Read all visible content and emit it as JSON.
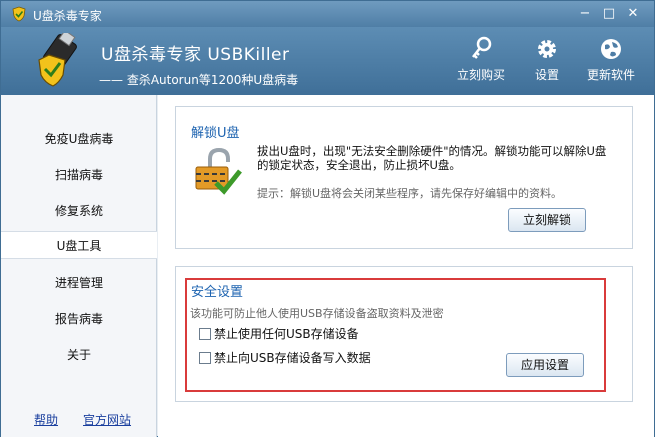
{
  "window": {
    "title": "U盘杀毒专家"
  },
  "header": {
    "product_name": "U盘杀毒专家  USBKiller",
    "tagline": "—— 查杀Autorun等1200种U盘病毒",
    "tools": [
      {
        "label": "立刻购买",
        "icon": "key-icon"
      },
      {
        "label": "设置",
        "icon": "gear-icon"
      },
      {
        "label": "更新软件",
        "icon": "globe-icon"
      }
    ]
  },
  "sidebar": {
    "items": [
      {
        "label": "免疫U盘病毒"
      },
      {
        "label": "扫描病毒"
      },
      {
        "label": "修复系统"
      },
      {
        "label": "U盘工具",
        "active": true
      },
      {
        "label": "进程管理"
      },
      {
        "label": "报告病毒"
      },
      {
        "label": "关于"
      }
    ],
    "footer": {
      "help": "帮助",
      "site": "官方网站"
    }
  },
  "unlock": {
    "title": "解锁U盘",
    "description": "拔出U盘时，出现\"无法安全删除硬件\"的情况。解锁功能可以解除U盘的锁定状态，安全退出，防止损坏U盘。",
    "hint": "提示：解锁U盘将会关闭某些程序，请先保存好编辑中的资料。",
    "button": "立刻解锁"
  },
  "security": {
    "title": "安全设置",
    "description": "该功能可防止他人使用USB存储设备盗取资料及泄密",
    "options": [
      {
        "label": "禁止使用任何USB存储设备",
        "checked": false
      },
      {
        "label": "禁止向USB存储设备写入数据",
        "checked": false
      }
    ],
    "button": "应用设置"
  },
  "colors": {
    "accent": "#1d63b0",
    "header": "#4f7ea6",
    "highlight": "#d93b3b"
  }
}
